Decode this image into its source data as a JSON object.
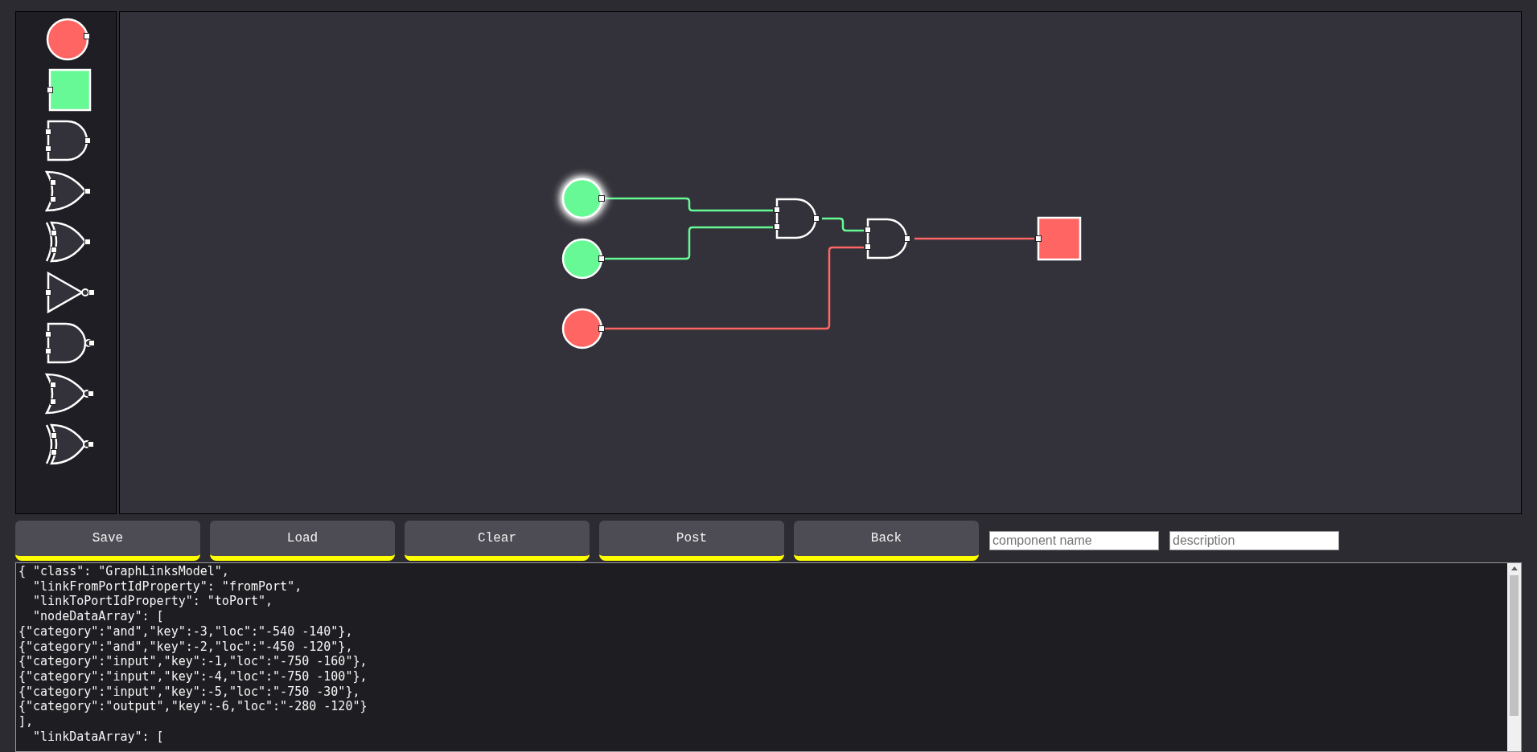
{
  "palette": [
    {
      "kind": "input",
      "on": false
    },
    {
      "kind": "output",
      "on": true
    },
    {
      "kind": "and"
    },
    {
      "kind": "or"
    },
    {
      "kind": "xor"
    },
    {
      "kind": "not"
    },
    {
      "kind": "nand"
    },
    {
      "kind": "nor"
    },
    {
      "kind": "xnor"
    }
  ],
  "diagram": {
    "nodes": [
      {
        "kind": "input",
        "on": true,
        "selected": true
      },
      {
        "kind": "input",
        "on": true,
        "selected": false
      },
      {
        "kind": "input",
        "on": false,
        "selected": false
      },
      {
        "kind": "and",
        "selected": false
      },
      {
        "kind": "and",
        "selected": false
      },
      {
        "kind": "output",
        "on": false,
        "selected": false
      }
    ],
    "links": [
      {
        "on": true
      },
      {
        "on": true
      },
      {
        "on": false
      },
      {
        "on": true
      },
      {
        "on": false
      }
    ]
  },
  "buttons": [
    "Save",
    "Load",
    "Clear",
    "Post",
    "Back"
  ],
  "fields": [
    {
      "placeholder": "component name"
    },
    {
      "placeholder": "description"
    }
  ],
  "model_text": [
    "{ \"class\": \"GraphLinksModel\",",
    "  \"linkFromPortIdProperty\": \"fromPort\",",
    "  \"linkToPortIdProperty\": \"toPort\",",
    "  \"nodeDataArray\": [",
    "{\"category\":\"and\",\"key\":-3,\"loc\":\"-540 -140\"},",
    "{\"category\":\"and\",\"key\":-2,\"loc\":\"-450 -120\"},",
    "{\"category\":\"input\",\"key\":-1,\"loc\":\"-750 -160\"},",
    "{\"category\":\"input\",\"key\":-4,\"loc\":\"-750 -100\"},",
    "{\"category\":\"input\",\"key\":-5,\"loc\":\"-750 -30\"},",
    "{\"category\":\"output\",\"key\":-6,\"loc\":\"-280 -120\"}",
    "],",
    "  \"linkDataArray\": ["
  ]
}
